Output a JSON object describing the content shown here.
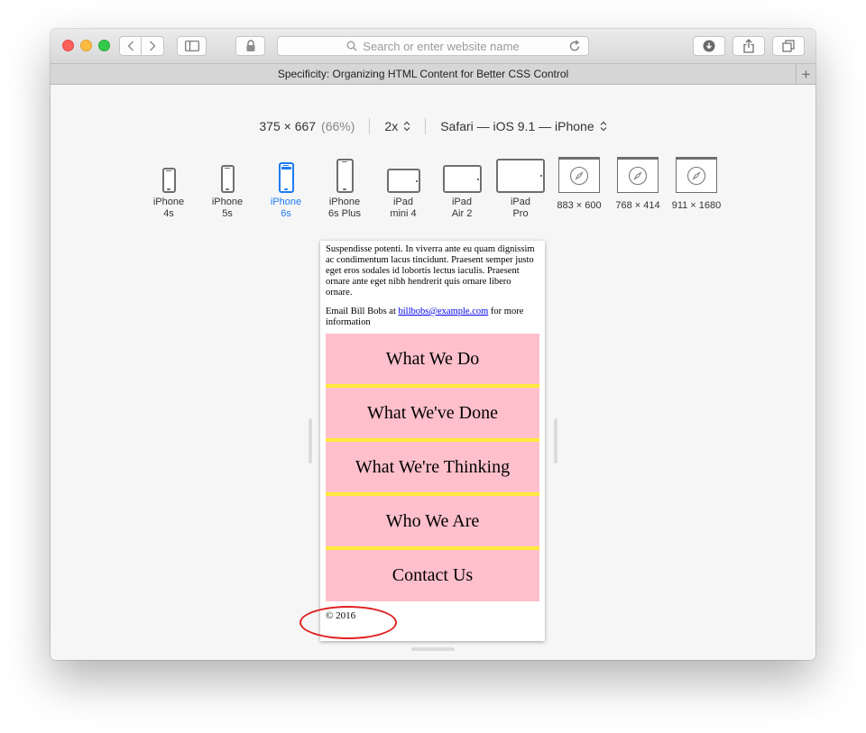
{
  "toolbar": {
    "address_placeholder": "Search or enter website name"
  },
  "tab": {
    "title": "Specificity: Organizing HTML Content for Better CSS Control",
    "new_tab_glyph": "+"
  },
  "responsive_design": {
    "resolution": "375 × 667",
    "zoom": "(66%)",
    "scale": "2x",
    "user_agent": "Safari — iOS 9.1 — iPhone",
    "devices": [
      {
        "line1": "iPhone",
        "line2": "4s"
      },
      {
        "line1": "iPhone",
        "line2": "5s"
      },
      {
        "line1": "iPhone",
        "line2": "6s"
      },
      {
        "line1": "iPhone",
        "line2": "6s Plus"
      },
      {
        "line1": "iPad",
        "line2": "mini 4"
      },
      {
        "line1": "iPad",
        "line2": "Air 2"
      },
      {
        "line1": "iPad",
        "line2": "Pro"
      },
      {
        "line1": "883 × 600"
      },
      {
        "line1": "768 × 414"
      },
      {
        "line1": "911 × 1680"
      }
    ],
    "active_device": "iPhone 6s"
  },
  "page": {
    "paragraph": "Suspendisse potenti. In viverra ante eu quam dignissim ac condimentum lacus tincidunt. Praesent semper justo eget eros sodales id lobortis lectus iaculis. Praesent ornare ante eget nibh hendrerit quis ornare libero ornare.",
    "email_prefix": "Email Bill Bobs at ",
    "email_link": "billbobs@example.com",
    "email_suffix": " for more information",
    "menu": [
      "What We Do",
      "What We've Done",
      "What We're Thinking",
      "Who We Are",
      "Contact Us"
    ],
    "copyright": "© 2016"
  },
  "colors": {
    "menu_background": "#ffc0cb",
    "menu_separator": "#ffeb3b",
    "annotation": "#e02020",
    "active_device": "#1e7bf2"
  }
}
